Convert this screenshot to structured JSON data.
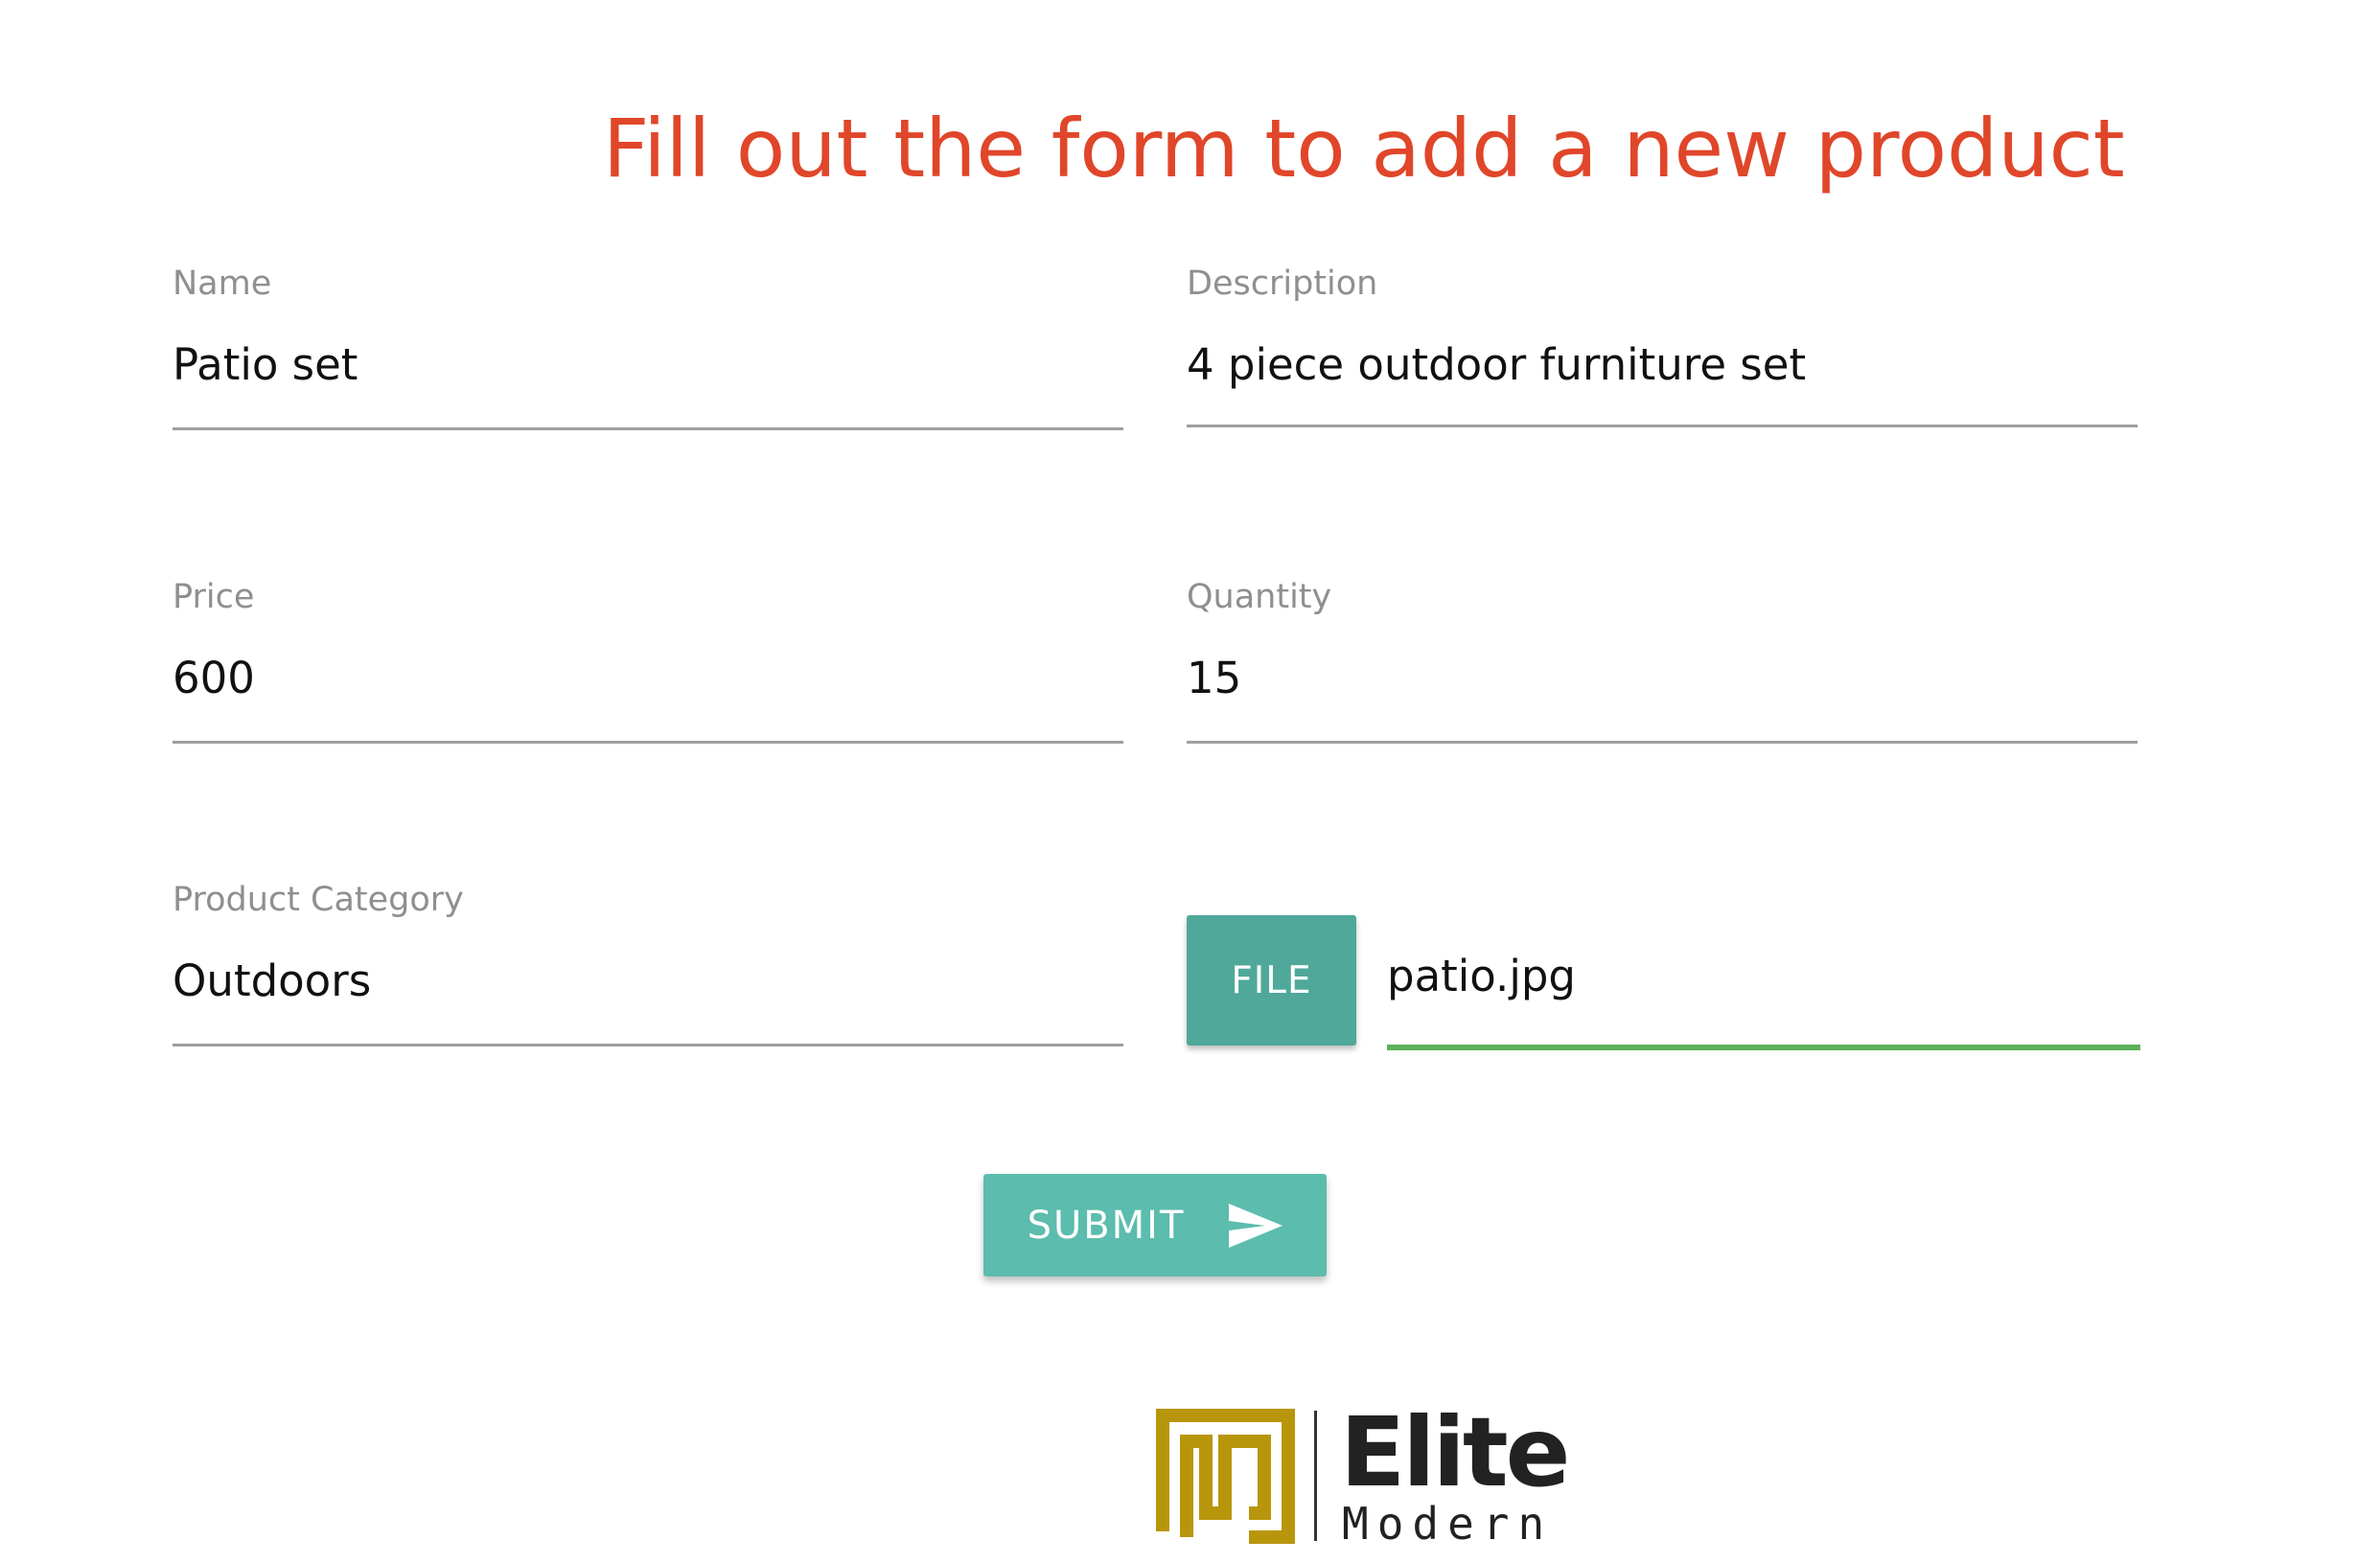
{
  "heading": "Fill out the form to add a new product",
  "form": {
    "name": {
      "label": "Name",
      "value": "Patio set"
    },
    "description": {
      "label": "Description",
      "value": "4 piece outdoor furniture set"
    },
    "price": {
      "label": "Price",
      "value": "600"
    },
    "quantity": {
      "label": "Quantity",
      "value": "15"
    },
    "category": {
      "label": "Product Category",
      "value": "Outdoors"
    },
    "file": {
      "button_label": "FILE",
      "file_name": "patio.jpg"
    }
  },
  "submit": {
    "label": "SUBMIT",
    "icon": "send-icon"
  },
  "logo": {
    "word1": "Elite",
    "word2": "Modern"
  },
  "colors": {
    "heading": "#e0462a",
    "file_button": "#4fa89a",
    "submit_button": "#5cbcad",
    "active_underline": "#5cb05a",
    "logo_gold": "#b8960c"
  }
}
